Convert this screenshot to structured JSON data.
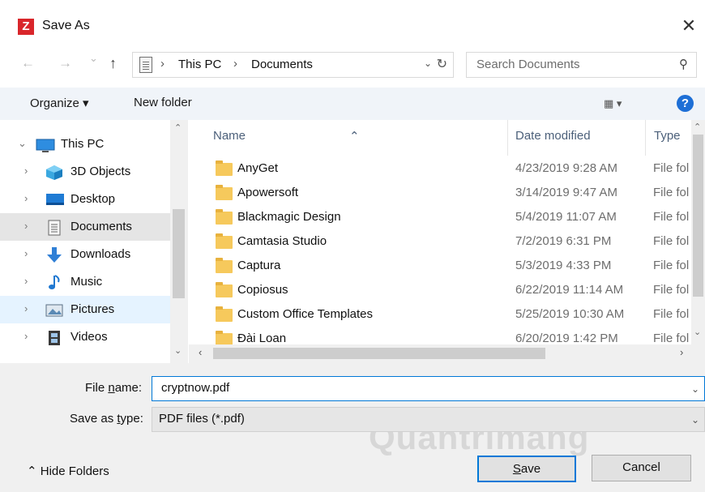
{
  "window": {
    "title": "Save As",
    "app_icon": "Z",
    "close_glyph": "✕"
  },
  "address": {
    "back_glyph": "←",
    "forward_glyph": "→",
    "recent_glyph": "⌄",
    "up_glyph": "↑",
    "crumbs": [
      "This PC",
      "Documents"
    ],
    "separator": "›",
    "dropdown_glyph": "⌄",
    "refresh_glyph": "↻"
  },
  "search": {
    "placeholder": "Search Documents",
    "icon_glyph": "⚲"
  },
  "toolbar": {
    "organize": "Organize ▾",
    "new_folder": "New folder",
    "view": "▦ ▾",
    "help": "?"
  },
  "nav": {
    "items": [
      {
        "label": "This PC",
        "icon": "monitor-icon",
        "chevron": "⌄"
      },
      {
        "label": "3D Objects",
        "icon": "cube-icon",
        "chevron": "›"
      },
      {
        "label": "Desktop",
        "icon": "desktop-icon",
        "chevron": "›"
      },
      {
        "label": "Documents",
        "icon": "document-icon",
        "chevron": "›"
      },
      {
        "label": "Downloads",
        "icon": "download-arrow-icon",
        "chevron": "›"
      },
      {
        "label": "Music",
        "icon": "music-note-icon",
        "chevron": "›"
      },
      {
        "label": "Pictures",
        "icon": "pictures-icon",
        "chevron": "›"
      },
      {
        "label": "Videos",
        "icon": "film-icon",
        "chevron": "›"
      }
    ],
    "scroll_up": "⌃",
    "scroll_down": "⌄"
  },
  "files": {
    "columns": [
      "Name",
      "Date modified",
      "Type"
    ],
    "sort_glyph": "⌃",
    "rows": [
      {
        "name": "AnyGet",
        "date": "4/23/2019 9:28 AM",
        "type": "File fol"
      },
      {
        "name": "Apowersoft",
        "date": "3/14/2019 9:47 AM",
        "type": "File fol"
      },
      {
        "name": "Blackmagic Design",
        "date": "5/4/2019 11:07 AM",
        "type": "File fol"
      },
      {
        "name": "Camtasia Studio",
        "date": "7/2/2019 6:31 PM",
        "type": "File fol"
      },
      {
        "name": "Captura",
        "date": "5/3/2019 4:33 PM",
        "type": "File fol"
      },
      {
        "name": "Copiosus",
        "date": "6/22/2019 11:14 AM",
        "type": "File fol"
      },
      {
        "name": "Custom Office Templates",
        "date": "5/25/2019 10:30 AM",
        "type": "File fol"
      },
      {
        "name": "Đài Loan",
        "date": "6/20/2019 1:42 PM",
        "type": "File fol"
      }
    ],
    "hscroll_left": "‹",
    "hscroll_right": "›",
    "vscroll_up": "⌃",
    "vscroll_down": "⌄"
  },
  "form": {
    "file_name_label_pre": "File ",
    "file_name_label_u": "n",
    "file_name_label_post": "ame:",
    "file_name_value": "cryptnow.pdf",
    "save_type_label_pre": "Save as ",
    "save_type_label_u": "t",
    "save_type_label_post": "ype:",
    "save_type_value": "PDF files (*.pdf)",
    "dropdown_glyph": "⌄",
    "hide_folders": "⌃  Hide Folders",
    "save_pre": "",
    "save_u": "S",
    "save_post": "ave",
    "cancel": "Cancel",
    "watermark": "Quantrimang"
  }
}
